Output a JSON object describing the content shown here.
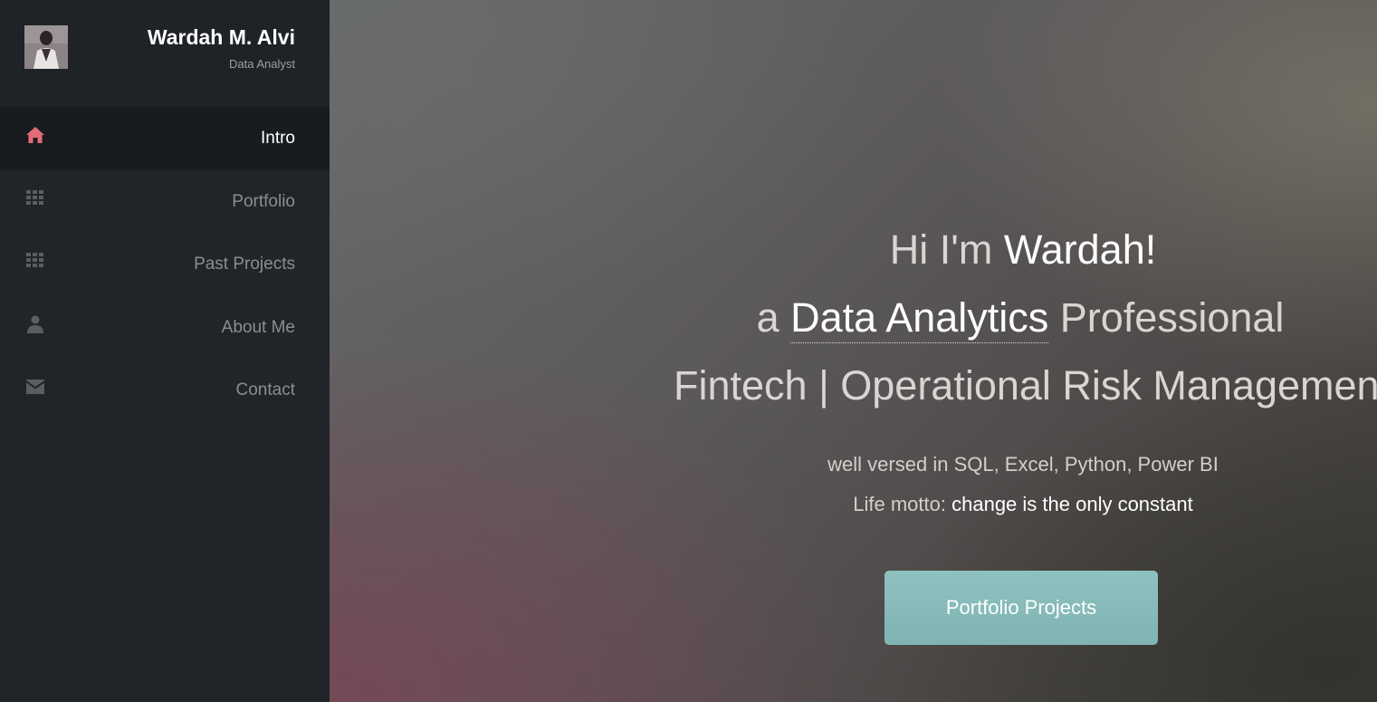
{
  "profile": {
    "name": "Wardah M. Alvi",
    "role": "Data Analyst"
  },
  "nav": {
    "items": [
      {
        "label": "Intro",
        "icon": "home-icon",
        "active": true
      },
      {
        "label": "Portfolio",
        "icon": "grid-icon",
        "active": false
      },
      {
        "label": "Past Projects",
        "icon": "grid-icon",
        "active": false
      },
      {
        "label": "About Me",
        "icon": "user-icon",
        "active": false
      },
      {
        "label": "Contact",
        "icon": "envelope-icon",
        "active": false
      }
    ]
  },
  "hero": {
    "line1_prefix": "Hi I'm ",
    "line1_name": "Wardah!",
    "line2_prefix": "a ",
    "line2_highlight": "Data Analytics",
    "line2_suffix": " Professional",
    "line3": "Fintech | Operational Risk Management",
    "skills": "well versed in SQL, Excel, Python, Power BI",
    "motto_label": "Life motto: ",
    "motto_text": "change is the only constant",
    "cta_label": "Portfolio Projects"
  },
  "colors": {
    "accent_icon": "#e36c78",
    "sidebar_bg": "#212429",
    "button_bg": "#86b9b8"
  }
}
